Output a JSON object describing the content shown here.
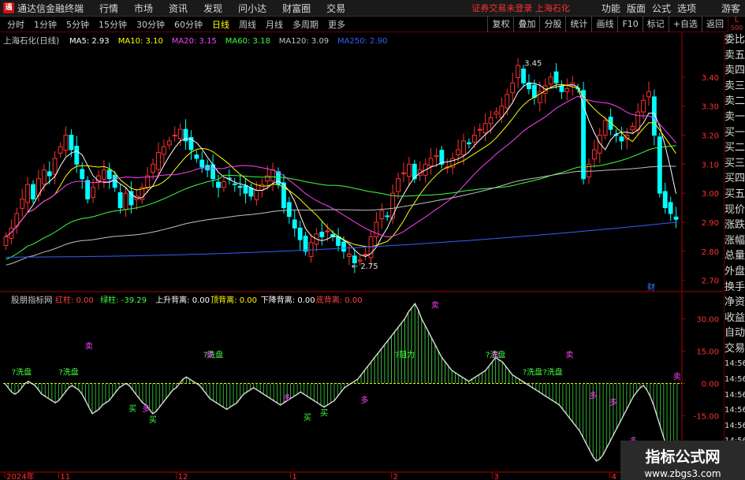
{
  "menubar": {
    "app_title": "通达信金融终端",
    "items": [
      "行情",
      "市场",
      "资讯",
      "发现",
      "问小达",
      "财富圈",
      "交易"
    ],
    "login_warning": "证券交易未登录  上海石化",
    "right_items": [
      "功能",
      "版面",
      "公式",
      "选项"
    ],
    "guest": "游客"
  },
  "periods": [
    "分时",
    "1分钟",
    "5分钟",
    "15分钟",
    "30分钟",
    "60分钟",
    "日线",
    "周线",
    "月线",
    "多周期",
    "更多"
  ],
  "active_period": "日线",
  "toolbar_right": [
    "复权",
    "叠加",
    "分股",
    "统计",
    "画线",
    "F10",
    "标记",
    "+自选",
    "返回"
  ],
  "l_badge": {
    "top": "L",
    "bottom": "500"
  },
  "sidebar": [
    "委比",
    "卖五",
    "卖四",
    "卖三",
    "卖二",
    "卖一",
    "买一",
    "买二",
    "买三",
    "买四",
    "买五",
    "现价",
    "涨跌",
    "涨幅",
    "总量",
    "外盘",
    "换手",
    "净资",
    "收益",
    "自动",
    "交易",
    "14:56",
    "14:56",
    "14:56",
    "14:56",
    "14:56",
    "14:56",
    "14:56",
    "14:56"
  ],
  "ma_header": {
    "title": "上海石化(日线)",
    "items": [
      {
        "label": "MA5: 2.93",
        "color": "#ffffff"
      },
      {
        "label": "MA10: 3.10",
        "color": "#ffff00"
      },
      {
        "label": "MA20: 3.15",
        "color": "#ff40ff"
      },
      {
        "label": "MA60: 3.18",
        "color": "#40ff40"
      },
      {
        "label": "MA120: 3.09",
        "color": "#c0c0c0"
      },
      {
        "label": "MA250: 2.90",
        "color": "#3060ff"
      }
    ]
  },
  "indicator_header": {
    "title": "股朋指标网",
    "items": [
      {
        "label": "红柱: 0.00",
        "color": "#ff4040"
      },
      {
        "label": "绿柱: -39.29",
        "color": "#40ff40"
      },
      {
        "label": "上升背离: 0.00",
        "color": "#ffffff"
      },
      {
        "label": "顶背离: 0.00",
        "color": "#ffff00"
      },
      {
        "label": "下降背离: 0.00",
        "color": "#ffffff"
      },
      {
        "label": "底背离: 0.00",
        "color": "#ff4040"
      }
    ]
  },
  "colors": {
    "up": "#ff3030",
    "down": "#00ffff",
    "axis": "#ff3030",
    "text": "#c0c0c0"
  },
  "chart_data": [
    {
      "type": "candlestick",
      "title": "上海石化(日线)",
      "ylim": [
        2.68,
        3.5
      ],
      "yticks": [
        2.7,
        2.8,
        2.9,
        3.0,
        3.1,
        3.2,
        3.3,
        3.4
      ],
      "annotations": [
        {
          "label": "3.45",
          "value": 3.45
        },
        {
          "label": "2.75",
          "value": 2.75
        },
        {
          "label": "财",
          "value": null
        }
      ],
      "closes": [
        2.85,
        2.88,
        2.93,
        2.98,
        3.03,
        2.98,
        3.05,
        3.08,
        3.06,
        3.12,
        3.16,
        3.2,
        3.15,
        3.1,
        3.05,
        2.98,
        3.02,
        3.06,
        3.08,
        3.05,
        3.02,
        2.95,
        3.0,
        2.96,
        2.99,
        3.02,
        3.06,
        3.1,
        3.14,
        3.16,
        3.18,
        3.2,
        3.22,
        3.18,
        3.15,
        3.12,
        3.09,
        3.08,
        3.05,
        3.02,
        3.04,
        3.05,
        3.03,
        3.02,
        3.0,
        2.99,
        3.01,
        3.03,
        3.06,
        3.08,
        3.03,
        2.95,
        2.92,
        2.88,
        2.84,
        2.8,
        2.83,
        2.86,
        2.85,
        2.87,
        2.85,
        2.82,
        2.8,
        2.79,
        2.76,
        2.77,
        2.79,
        2.85,
        2.9,
        2.94,
        2.92,
        3.0,
        3.05,
        3.07,
        3.1,
        3.05,
        3.08,
        3.1,
        3.12,
        3.13,
        3.1,
        3.09,
        3.12,
        3.15,
        3.18,
        3.17,
        3.2,
        3.22,
        3.24,
        3.26,
        3.28,
        3.3,
        3.34,
        3.38,
        3.44,
        3.38,
        3.36,
        3.33,
        3.35,
        3.37,
        3.4,
        3.38,
        3.35,
        3.36,
        3.38,
        3.36,
        3.05,
        3.1,
        3.15,
        3.2,
        3.25,
        3.22,
        3.2,
        3.18,
        3.2,
        3.23,
        3.28,
        3.32,
        3.35,
        3.2,
        3.0,
        2.95,
        2.93,
        2.91
      ],
      "series": [
        {
          "name": "MA5",
          "color": "#ffffff"
        },
        {
          "name": "MA10",
          "color": "#ffff00"
        },
        {
          "name": "MA20",
          "color": "#ff40ff"
        },
        {
          "name": "MA60",
          "color": "#40ff40"
        },
        {
          "name": "MA120",
          "color": "#c0c0c0"
        },
        {
          "name": "MA250",
          "color": "#3060ff"
        }
      ]
    },
    {
      "type": "bar",
      "title": "股朋指标网",
      "ylim": [
        -40,
        40
      ],
      "yticks": [
        30.0,
        15.0,
        0.0,
        -15.0,
        -30.0
      ],
      "ytick_labels": [
        "30.00",
        "15.00",
        "0.00",
        "-15.00",
        "-30.00"
      ],
      "xticks": [
        "2024年",
        "11",
        "12",
        "1",
        "2",
        "3",
        "4"
      ],
      "xtick_positions": [
        0,
        16,
        51,
        85,
        115,
        145,
        180
      ],
      "labels": [
        {
          "text": "?洗盘",
          "color": "#40ff40",
          "at": 5,
          "y": 4
        },
        {
          "text": "?洗盘",
          "color": "#40ff40",
          "at": 19,
          "y": 4
        },
        {
          "text": "卖",
          "color": "#ff40ff",
          "at": 25,
          "y": 16
        },
        {
          "text": "?洗盘",
          "color": "#40ff40",
          "at": 62,
          "y": 12
        },
        {
          "text": "卖",
          "color": "#ff40ff",
          "at": 61,
          "y": 12
        },
        {
          "text": "?阻力",
          "color": "#40ff40",
          "at": 119,
          "y": 12
        },
        {
          "text": "卖",
          "color": "#ff40ff",
          "at": 128,
          "y": 35
        },
        {
          "text": "?洗盘",
          "color": "#40ff40",
          "at": 146,
          "y": 12
        },
        {
          "text": "卖",
          "color": "#ff40ff",
          "at": 146,
          "y": 12
        },
        {
          "text": "?洗盘",
          "color": "#40ff40",
          "at": 157,
          "y": 4
        },
        {
          "text": "?洗盘",
          "color": "#40ff40",
          "at": 163,
          "y": 4
        },
        {
          "text": "卖",
          "color": "#ff40ff",
          "at": 168,
          "y": 12
        },
        {
          "text": "卖",
          "color": "#ff40ff",
          "at": 208,
          "y": 2
        },
        {
          "text": "买",
          "color": "#40ff40",
          "at": 38,
          "y": -13
        },
        {
          "text": "多",
          "color": "#ff40ff",
          "at": 42,
          "y": -13
        },
        {
          "text": "买",
          "color": "#40ff40",
          "at": 44,
          "y": -18
        },
        {
          "text": "多",
          "color": "#ff40ff",
          "at": 84,
          "y": -8
        },
        {
          "text": "买",
          "color": "#40ff40",
          "at": 90,
          "y": -17
        },
        {
          "text": "买",
          "color": "#40ff40",
          "at": 95,
          "y": -15
        },
        {
          "text": "多",
          "color": "#ff40ff",
          "at": 107,
          "y": -9
        },
        {
          "text": "多",
          "color": "#ff40ff",
          "at": 175,
          "y": -7
        },
        {
          "text": "多",
          "color": "#ff40ff",
          "at": 181,
          "y": -10
        },
        {
          "text": "多",
          "color": "#ff40ff",
          "at": 187,
          "y": -28
        },
        {
          "text": "买",
          "color": "#40ff40",
          "at": 193,
          "y": -36
        }
      ],
      "values": [
        0,
        -2,
        -4,
        -5,
        -4,
        -2,
        0,
        1,
        0,
        -1,
        -3,
        -5,
        -6,
        -7,
        -8,
        -9,
        -8,
        -6,
        -4,
        -2,
        -1,
        -2,
        -3,
        -5,
        -8,
        -11,
        -14,
        -13,
        -12,
        -10,
        -9,
        -8,
        -6,
        -4,
        -2,
        -1,
        0,
        -1,
        -3,
        -5,
        -7,
        -9,
        -10,
        -12,
        -14,
        -13,
        -11,
        -9,
        -7,
        -5,
        -3,
        -2,
        0,
        2,
        3,
        2,
        1,
        0,
        -1,
        -3,
        -5,
        -7,
        -8,
        -9,
        -10,
        -11,
        -12,
        -11,
        -10,
        -9,
        -7,
        -5,
        -4,
        -3,
        -2,
        -3,
        -4,
        -5,
        -6,
        -7,
        -8,
        -9,
        -10,
        -9,
        -8,
        -7,
        -6,
        -5,
        -4,
        -5,
        -6,
        -7,
        -8,
        -9,
        -10,
        -11,
        -10,
        -9,
        -8,
        -6,
        -4,
        -2,
        -1,
        0,
        1,
        2,
        4,
        6,
        8,
        10,
        12,
        14,
        16,
        18,
        20,
        22,
        24,
        26,
        28,
        30,
        33,
        35,
        37,
        34,
        30,
        27,
        24,
        21,
        18,
        15,
        12,
        10,
        8,
        6,
        5,
        4,
        3,
        2,
        1,
        2,
        3,
        4,
        5,
        6,
        8,
        10,
        12,
        11,
        10,
        8,
        6,
        4,
        3,
        2,
        1,
        0,
        -1,
        -2,
        -3,
        -4,
        -5,
        -6,
        -7,
        -8,
        -9,
        -10,
        -12,
        -14,
        -16,
        -18,
        -20,
        -22,
        -25,
        -28,
        -31,
        -34,
        -36,
        -35,
        -33,
        -30,
        -27,
        -24,
        -21,
        -18,
        -15,
        -12,
        -9,
        -6,
        -4,
        -2,
        -1,
        -3,
        -6,
        -10,
        -15,
        -20,
        -25,
        -30,
        -35,
        -38,
        -39
      ]
    }
  ],
  "watermark": {
    "title": "指标公式网",
    "url": "www.zbgs3.com"
  }
}
